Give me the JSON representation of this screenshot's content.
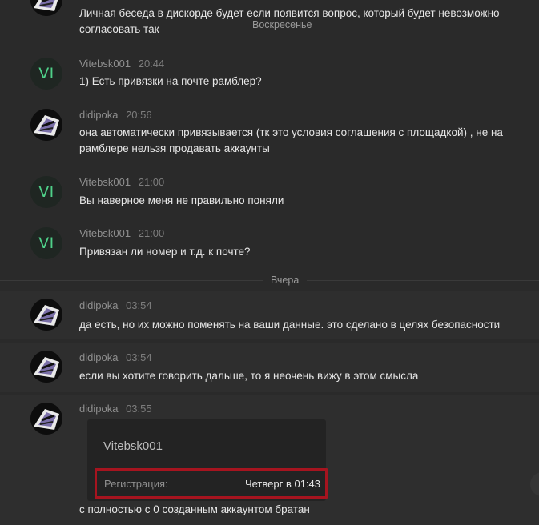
{
  "dividers": {
    "sunday": "Воскресенье",
    "yesterday": "Вчера"
  },
  "messages": [
    {
      "author": "",
      "time": "",
      "avatar": "anime-avatar-icon",
      "text": "Личная беседа в дискорде будет если появится вопрос, который будет невозможно согласовать так"
    },
    {
      "author": "Vitebsk001",
      "time": "20:44",
      "avatar_initials": "VI",
      "text": "1) Есть привязки на почте рамблер?"
    },
    {
      "author": "didipoka",
      "time": "20:56",
      "avatar": "anime-avatar-icon",
      "text": "она автоматически привязывается (тк это условия соглашения с площадкой) , не на рамблере нельзя продавать аккаунты"
    },
    {
      "author": "Vitebsk001",
      "time": "21:00",
      "avatar_initials": "VI",
      "text": "Вы наверное меня не правильно поняли"
    },
    {
      "author": "Vitebsk001",
      "time": "21:00",
      "avatar_initials": "VI",
      "text": "Привязан ли номер и т.д. к почте?"
    },
    {
      "author": "didipoka",
      "time": "03:54",
      "avatar": "anime-avatar-icon",
      "text": "да есть, но их можно поменять на ваши данные. это сделано в целях безопасности"
    },
    {
      "author": "didipoka",
      "time": "03:54",
      "avatar": "anime-avatar-icon",
      "text": "если вы хотите говорить дальше, то я неочень вижу в этом смысла"
    },
    {
      "author": "didipoka",
      "time": "03:55",
      "avatar": "anime-avatar-icon",
      "text": "с полностью с 0 созданным аккаунтом братан",
      "embed": {
        "username": "Vitebsk001",
        "field_label": "Регистрация:",
        "field_value": "Четверг в 01:43"
      }
    }
  ],
  "colors": {
    "background": "#2a2a2a",
    "highlight": "#2e2e2e",
    "initials": "#4fd189",
    "frame": "#a6141f"
  }
}
